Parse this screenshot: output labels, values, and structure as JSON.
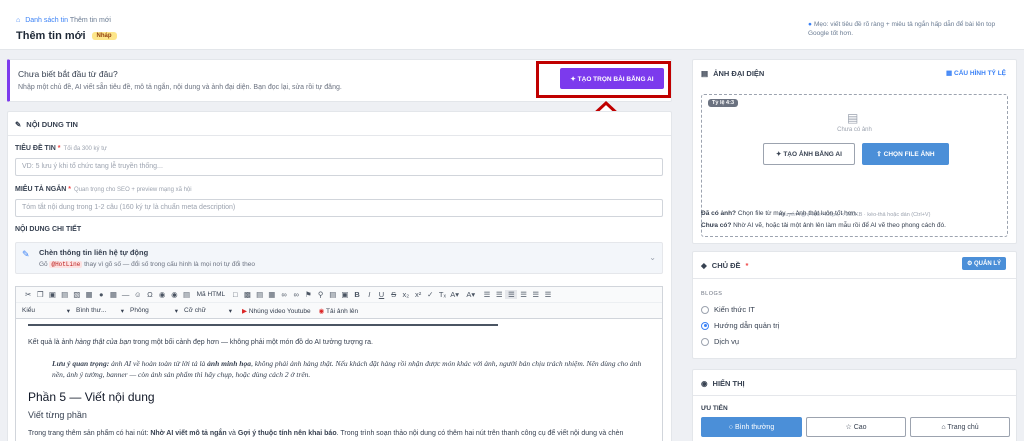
{
  "header": {
    "breadcrumb_parent": "Danh sách tin",
    "breadcrumb_current": "Thêm tin mới",
    "title": "Thêm tin mới",
    "status_badge": "Nháp",
    "tip": "Mẹo: viết tiêu đề rõ ràng + miêu tả ngắn hấp dẫn để bài lên top Google tốt hơn."
  },
  "ai_banner": {
    "question": "Chưa biết bắt đầu từ đâu?",
    "description": "Nhập một chủ đề, AI viết sẵn tiêu đề, mô tả ngắn, nội dung và ảnh đại diện. Bạn đọc lại, sửa rồi tự đăng.",
    "button_label": "TẠO TRỌN BÀI BẰNG AI"
  },
  "content_section": {
    "heading": "NỘI DUNG TIN",
    "title_label": "TIÊU ĐỀ TIN",
    "title_hint": "Tối đa 300 ký tự",
    "title_placeholder": "VD: 5 lưu ý khi tổ chức tang lễ truyền thống...",
    "summary_label": "MIÊU TẢ NGẮN",
    "summary_hint": "Quan trọng cho SEO + preview mạng xã hội",
    "summary_placeholder": "Tóm tắt nội dung trong 1-2 câu (160 ký tự là chuẩn meta description)",
    "detail_label": "NỘI DUNG CHI TIẾT",
    "contact_title": "Chèn thông tin liên hệ tự động",
    "contact_pre": "Gõ",
    "contact_code": "@HotLine",
    "contact_post": "thay vì gõ số — đổi số trong cấu hình là mọi nơi tự đổi theo"
  },
  "toolbar": {
    "html_label": "Mã HTML",
    "style": "Kiểu",
    "format": "Bình thư...",
    "font": "Phông",
    "size": "Cỡ chữ",
    "youtube": "Nhúng video Youtube",
    "image": "Tải ảnh lên"
  },
  "editor": {
    "p1_a": "Kết quả là ảnh ",
    "p1_i": "hàng thật của bạn",
    "p1_b": " trong một bối cảnh đẹp hơn — không phải một món đồ do AI tưởng tượng ra.",
    "quote_b1": "Lưu ý quan trọng:",
    "quote_a": " ảnh AI về hoàn toàn từ lời tả là ",
    "quote_b2": "ảnh minh họa",
    "quote_c": ", không phải ảnh hàng thật. Nếu khách đặt hàng rồi nhận được món khác với ảnh, người bán chịu trách nhiệm. Nên dùng cho ảnh nền, ảnh ý tưởng, banner — còn ảnh sản phẩm thì hãy chụp, hoặc dùng cách 2 ở trên.",
    "h2": "Phần 5 — Viết nội dung",
    "h3": "Viết từng phần",
    "p2_a": "Trong trang thêm sản phẩm có hai nút: ",
    "p2_b1": "Nhờ AI viết mô tả ngắn",
    "p2_m": " và ",
    "p2_b2": "Gợi ý thuộc tính nên khai báo",
    "p2_c": ". Trong trình soạn thảo nội dung có thêm hai nút trên thanh công cụ để viết nội dung và chèn"
  },
  "image_card": {
    "heading": "ẢNH ĐẠI DIỆN",
    "config_link": "CẤU HÌNH TỶ LỆ",
    "ratio_badge": "Tỷ lệ 4:3",
    "no_image": "Chưa có ảnh",
    "ai_button": "TẠO ẢNH BẰNG AI",
    "file_button": "CHỌN FILE ẢNH",
    "recommend": "Khuyến nghị 400×400px, < 200KB · kéo-thả hoặc dán (Ctrl+V)",
    "note1_b": "Đã có ảnh?",
    "note1": " Chọn file từ máy — ảnh thật luôn tốt hơn.",
    "note2_b": "Chưa có?",
    "note2": " Nhờ AI vẽ, hoặc tải một ảnh lên làm mẫu rồi để AI vẽ theo phong cách đó."
  },
  "category_card": {
    "heading": "CHỦ ĐỀ",
    "manage_button": "QUẢN LÝ",
    "group": "BLOGS",
    "items": [
      "Kiến thức IT",
      "Hướng dẫn quản trị",
      "Dịch vụ"
    ],
    "selected": "Hướng dẫn quản trị"
  },
  "display_card": {
    "heading": "HIỂN THỊ",
    "priority_label": "ƯU TIÊN",
    "options": [
      "Bình thường",
      "Cao",
      "Trang chủ"
    ],
    "selected": "Bình thường"
  }
}
